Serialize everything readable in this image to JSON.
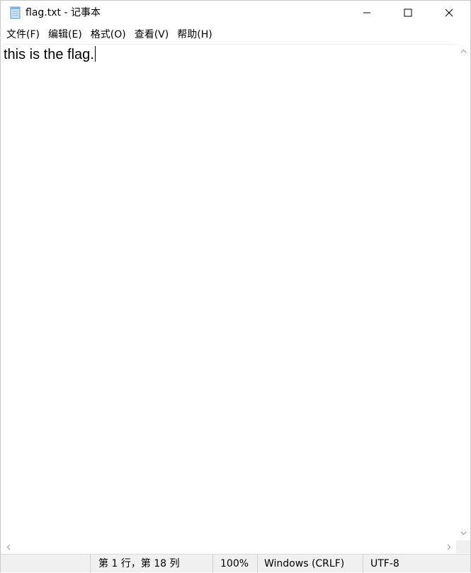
{
  "window": {
    "title": "flag.txt - 记事本",
    "icon": "notepad-icon",
    "controls": {
      "minimize_icon": "minimize-icon",
      "maximize_icon": "maximize-icon",
      "close_icon": "close-icon"
    }
  },
  "menubar": {
    "items": [
      {
        "label": "文件(F)"
      },
      {
        "label": "编辑(E)"
      },
      {
        "label": "格式(O)"
      },
      {
        "label": "查看(V)"
      },
      {
        "label": "帮助(H)"
      }
    ]
  },
  "editor": {
    "content": "this is the flag."
  },
  "statusbar": {
    "position": "第 1 行，第 18 列",
    "zoom": "100%",
    "line_ending": "Windows (CRLF)",
    "encoding": "UTF-8"
  },
  "colors": {
    "statusbar_bg": "#f0f0f0",
    "window_bg": "#ffffff",
    "border": "#c8c8c8"
  }
}
